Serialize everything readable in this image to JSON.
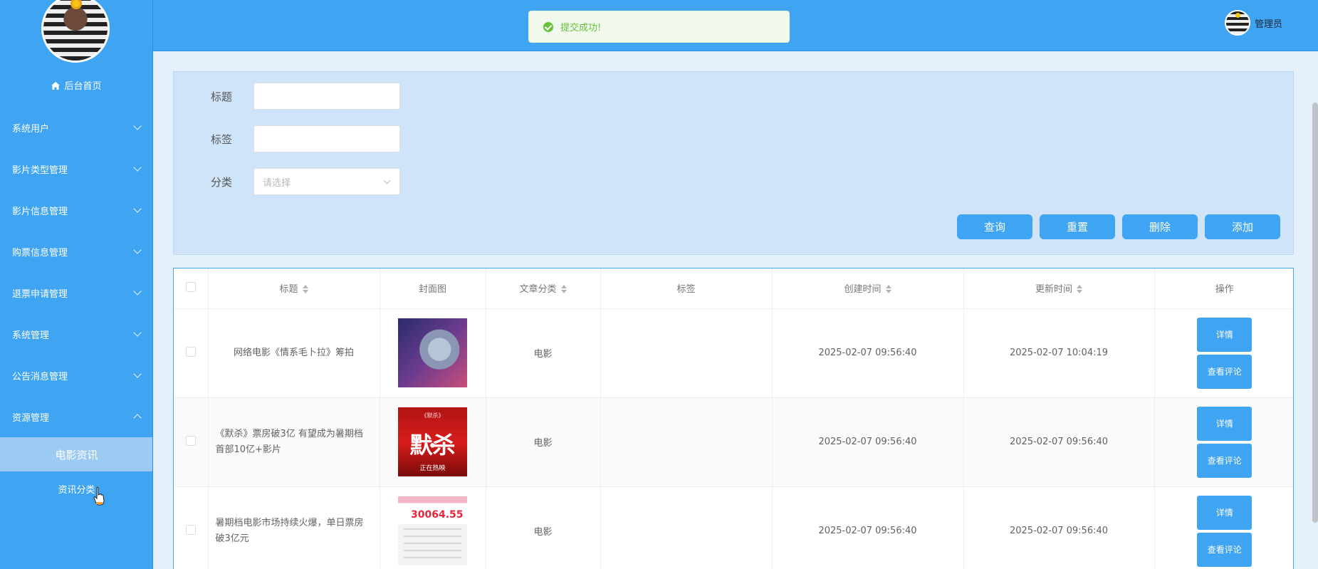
{
  "sidebar": {
    "home_label": "后台首页",
    "menu": [
      {
        "label": "系统用户"
      },
      {
        "label": "影片类型管理"
      },
      {
        "label": "影片信息管理"
      },
      {
        "label": "购票信息管理"
      },
      {
        "label": "退票申请管理"
      },
      {
        "label": "系统管理"
      },
      {
        "label": "公告消息管理"
      },
      {
        "label": "资源管理"
      }
    ],
    "submenu": [
      {
        "label": "电影资讯",
        "active": true
      },
      {
        "label": "资讯分类"
      }
    ]
  },
  "header": {
    "user_name": "管理员"
  },
  "toast": {
    "message": "提交成功!"
  },
  "search": {
    "title_label": "标题",
    "tag_label": "标签",
    "category_label": "分类",
    "category_placeholder": "请选择",
    "buttons": {
      "query": "查询",
      "reset": "重置",
      "delete": "删除",
      "add": "添加"
    }
  },
  "table": {
    "columns": {
      "title": "标题",
      "cover": "封面图",
      "category": "文章分类",
      "tags": "标签",
      "created": "创建时间",
      "updated": "更新时间",
      "actions": "操作"
    },
    "rows": [
      {
        "title": "网络电影《情系毛卜拉》筹拍",
        "category": "电影",
        "tags": "",
        "created": "2025-02-07 09:56:40",
        "updated": "2025-02-07 10:04:19"
      },
      {
        "title": "《默杀》票房破3亿 有望成为暑期档首部10亿+影片",
        "category": "电影",
        "tags": "",
        "created": "2025-02-07 09:56:40",
        "updated": "2025-02-07 09:56:40"
      },
      {
        "title": "暑期档电影市场持续火爆，单日票房破3亿元",
        "category": "电影",
        "tags": "",
        "created": "2025-02-07 09:56:40",
        "updated": "2025-02-07 09:56:40"
      }
    ],
    "action_labels": {
      "detail": "详情",
      "comments": "查看评论"
    },
    "cover_texts": {
      "row2_top": "《默杀》",
      "row2_main": "默杀",
      "row2_bottom": "正在热映",
      "row3_number": "30064.55"
    }
  },
  "colors": {
    "primary": "#3fa4f1",
    "success": "#67c23a"
  }
}
